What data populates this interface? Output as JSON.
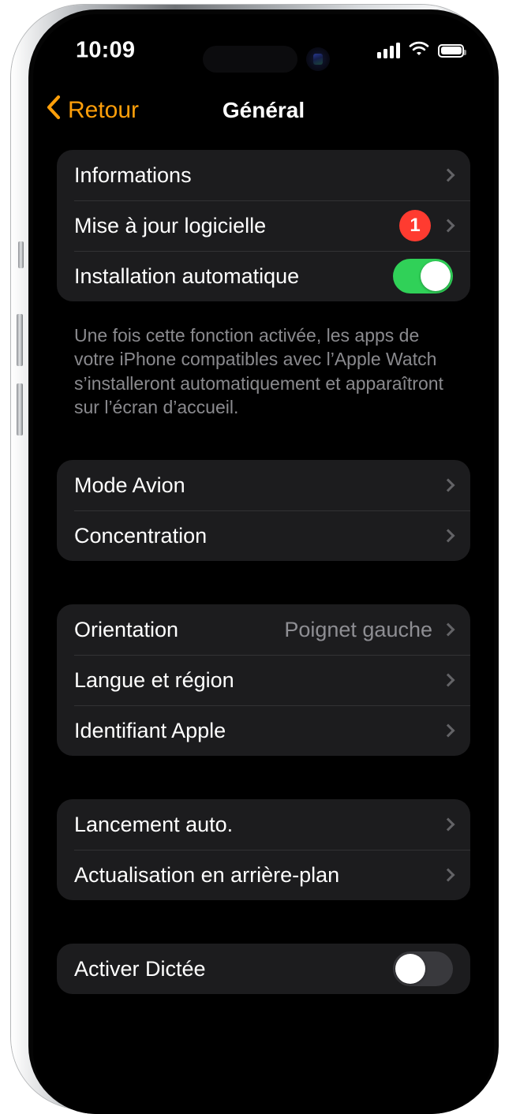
{
  "device": {
    "frame_color": "#b9bcc0",
    "screen_background": "#000000"
  },
  "status_bar": {
    "time": "10:09",
    "cellular_icon": "cellular-bars-icon",
    "wifi_icon": "wifi-icon",
    "battery_icon": "battery-full-icon",
    "battery_level_percent": 100
  },
  "nav": {
    "back_label": "Retour",
    "back_icon": "chevron-left-icon",
    "title": "Général",
    "accent_color": "#ff9f0a"
  },
  "colors": {
    "card": "#1c1c1e",
    "separator": "#323234",
    "label": "#ffffff",
    "secondary_label": "#8e8e93",
    "toggle_on": "#30d158",
    "toggle_off": "#39393d",
    "badge_red": "#ff3b30",
    "chevron": "#636366"
  },
  "groups": [
    {
      "name": "updates-group",
      "rows": [
        {
          "label": "Informations",
          "type": "disclosure"
        },
        {
          "label": "Mise à jour logicielle",
          "type": "disclosure",
          "badge": "1"
        },
        {
          "label": "Installation automatique",
          "type": "toggle",
          "toggle_state": "on"
        }
      ],
      "footer": "Une fois cette fonction activée, les apps de votre iPhone compatibles avec l’Apple Watch s’installeront automatiquement et apparaîtront sur l’écran d’accueil."
    },
    {
      "name": "modes-group",
      "rows": [
        {
          "label": "Mode Avion",
          "type": "disclosure"
        },
        {
          "label": "Concentration",
          "type": "disclosure"
        }
      ]
    },
    {
      "name": "device-group",
      "rows": [
        {
          "label": "Orientation",
          "type": "disclosure",
          "value": "Poignet gauche"
        },
        {
          "label": "Langue et région",
          "type": "disclosure"
        },
        {
          "label": "Identifiant Apple",
          "type": "disclosure"
        }
      ]
    },
    {
      "name": "apps-group",
      "rows": [
        {
          "label": "Lancement auto.",
          "type": "disclosure"
        },
        {
          "label": "Actualisation en arrière-plan",
          "type": "disclosure"
        }
      ]
    },
    {
      "name": "dictation-group",
      "rows": [
        {
          "label": "Activer Dictée",
          "type": "toggle",
          "toggle_state": "off"
        }
      ]
    }
  ]
}
